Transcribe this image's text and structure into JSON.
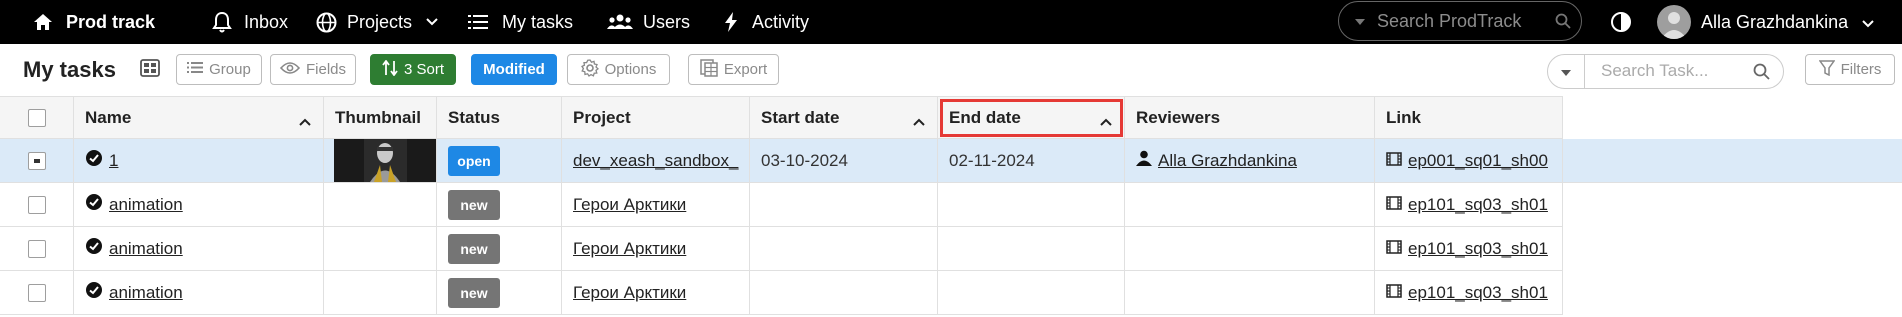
{
  "nav": {
    "brand": "Prod track",
    "inbox": "Inbox",
    "projects": "Projects",
    "my_tasks": "My tasks",
    "users": "Users",
    "activity": "Activity",
    "search_placeholder": "Search ProdTrack",
    "user_name": "Alla Grazhdankina"
  },
  "toolbar": {
    "title": "My tasks",
    "group": "Group",
    "fields": "Fields",
    "sort": "3 Sort",
    "modified": "Modified",
    "options": "Options",
    "export": "Export",
    "task_search_placeholder": "Search Task...",
    "filters": "Filters"
  },
  "table": {
    "columns": {
      "name": "Name",
      "thumbnail": "Thumbnail",
      "status": "Status",
      "project": "Project",
      "start_date": "Start date",
      "end_date": "End date",
      "reviewers": "Reviewers",
      "link": "Link"
    },
    "rows": [
      {
        "name": "1",
        "status": "open",
        "project": "dev_xeash_sandbox_",
        "start_date": "03-10-2024",
        "end_date": "02-11-2024",
        "reviewer": "Alla Grazhdankina",
        "link": "ep001_sq01_sh00"
      },
      {
        "name": "animation",
        "status": "new",
        "project": "Герои Арктики",
        "start_date": "",
        "end_date": "",
        "reviewer": "",
        "link": "ep101_sq03_sh01"
      },
      {
        "name": "animation",
        "status": "new",
        "project": "Герои Арктики",
        "start_date": "",
        "end_date": "",
        "reviewer": "",
        "link": "ep101_sq03_sh01"
      },
      {
        "name": "animation",
        "status": "new",
        "project": "Герои Арктики",
        "start_date": "",
        "end_date": "",
        "reviewer": "",
        "link": "ep101_sq03_sh01"
      }
    ]
  },
  "colors": {
    "sort_button": "#2e7d32",
    "modified_button": "#1e88e5",
    "status_open": "#1e88e5",
    "status_new": "#757575",
    "selected_row": "#dbeaf8",
    "highlight_outline": "#e53935"
  }
}
